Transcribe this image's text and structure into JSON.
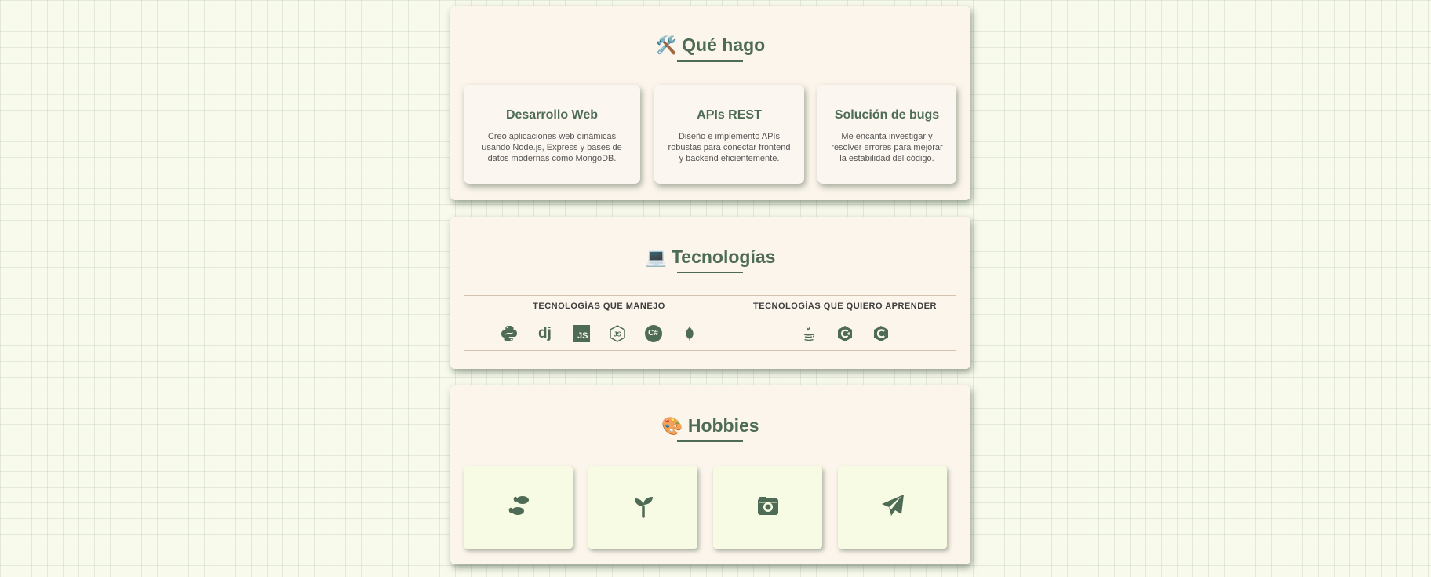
{
  "sections": {
    "que_hago": {
      "emoji": "🛠️",
      "title": "Qué hago",
      "cards": [
        {
          "title": "Desarrollo Web",
          "text": "Creo aplicaciones web dinámicas usando Node.js, Express y bases de datos modernas como MongoDB."
        },
        {
          "title": "APIs REST",
          "text": "Diseño e implemento APIs robustas para conectar frontend y backend eficientemente."
        },
        {
          "title": "Solución de bugs",
          "text": "Me encanta investigar y resolver errores para mejorar la estabilidad del código."
        }
      ]
    },
    "tecnologias": {
      "emoji": "💻",
      "title": "Tecnologías",
      "col_known": "TECNOLOGÍAS QUE MANEJO",
      "col_learn": "TECNOLOGÍAS QUE QUIERO APRENDER",
      "known_icons": [
        "python-icon",
        "django-icon",
        "javascript-icon",
        "nodejs-icon",
        "csharp-icon",
        "mongodb-icon"
      ],
      "learn_icons": [
        "java-icon",
        "cplusplus-icon",
        "c-icon"
      ],
      "icon_labels": {
        "django": "dj",
        "js": "JS",
        "csharp": "C#"
      }
    },
    "hobbies": {
      "emoji": "🎨",
      "title": "Hobbies",
      "icons": [
        "footprints-icon",
        "seedling-icon",
        "camera-retro-icon",
        "paper-plane-icon"
      ]
    }
  },
  "colors": {
    "accent": "#4d6b55",
    "section_bg": "#fcf5eb",
    "page_bg": "#f8faec",
    "hobby_card_bg": "#f8fbe3",
    "table_border": "#d6c0ae"
  }
}
